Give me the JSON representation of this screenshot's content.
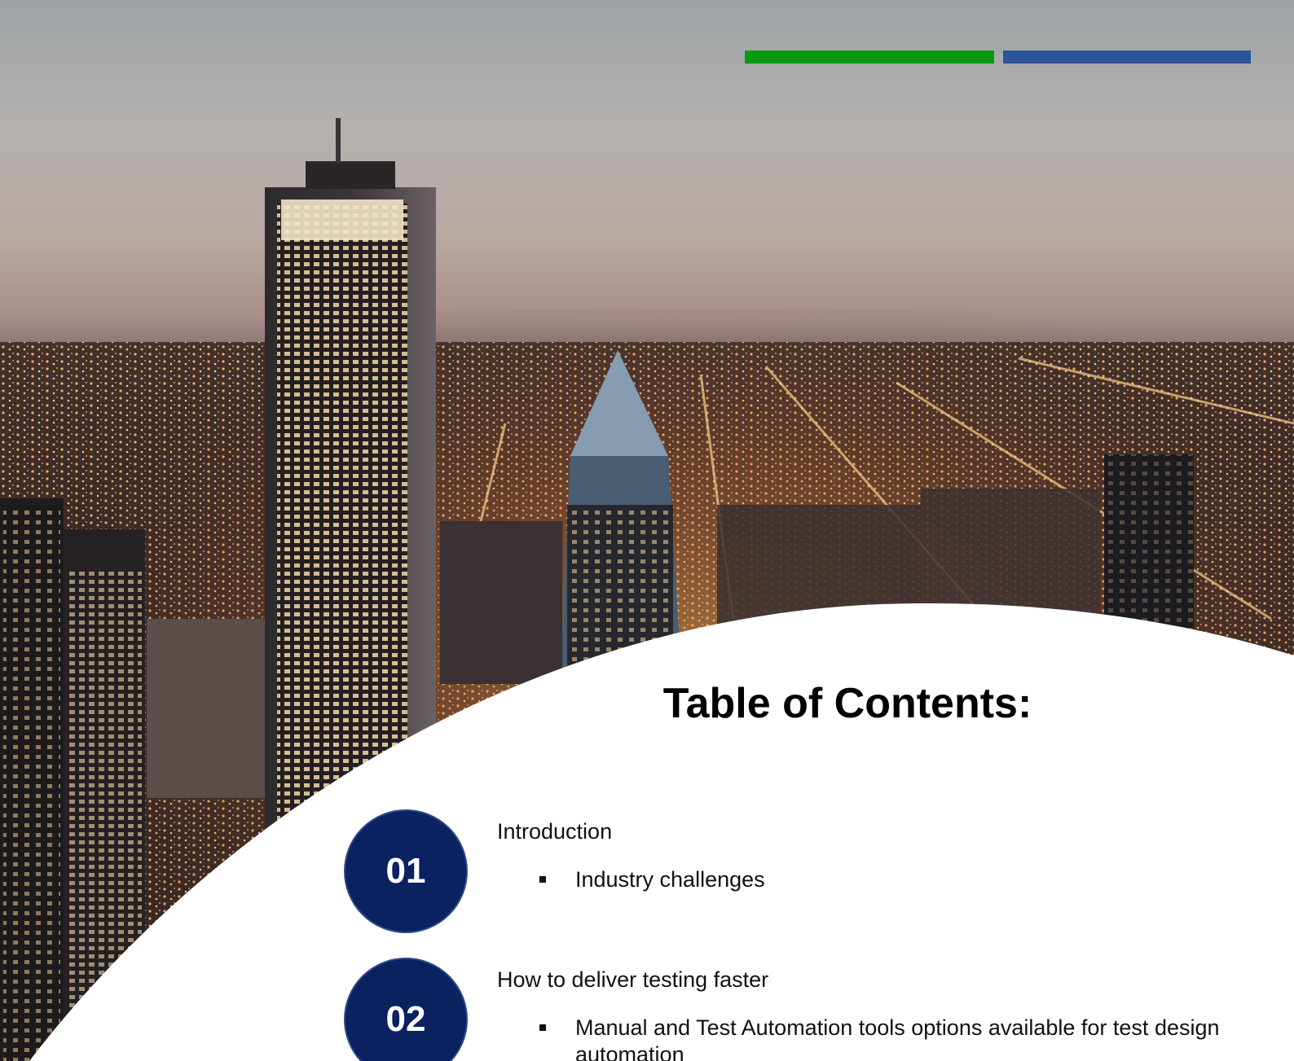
{
  "accent_colors": {
    "green": "#089a12",
    "blue": "#2c559a",
    "circle": "#0b2160"
  },
  "background": {
    "kind": "photo",
    "subject": "city-skyline-at-dusk"
  },
  "toc": {
    "title": "Table of Contents:",
    "items": [
      {
        "number": "01",
        "heading": "Introduction",
        "subitems": [
          "Industry challenges"
        ]
      },
      {
        "number": "02",
        "heading": "How to deliver testing faster",
        "subitems": [
          "Manual and Test Automation tools options available for test design automation"
        ]
      }
    ]
  }
}
